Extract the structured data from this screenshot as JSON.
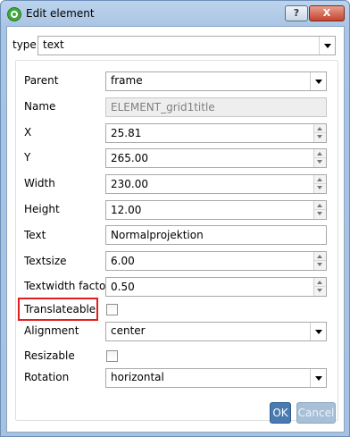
{
  "window": {
    "title": "Edit element"
  },
  "titlebar": {
    "help_label": "?",
    "close_label": "X"
  },
  "type_row": {
    "label": "type",
    "value": "text"
  },
  "fields": {
    "parent": {
      "label": "Parent",
      "value": "frame"
    },
    "name": {
      "label": "Name",
      "value": "ELEMENT_grid1title"
    },
    "x": {
      "label": "X",
      "value": "25.81"
    },
    "y": {
      "label": "Y",
      "value": "265.00"
    },
    "width": {
      "label": "Width",
      "value": "230.00"
    },
    "height": {
      "label": "Height",
      "value": "12.00"
    },
    "text": {
      "label": "Text",
      "value": "Normalprojektion"
    },
    "textsize": {
      "label": "Textsize",
      "value": "6.00"
    },
    "textwidth_factor": {
      "label": "Textwidth factor",
      "value": "0.50"
    },
    "translateable": {
      "label": "Translateable",
      "checked": false
    },
    "alignment": {
      "label": "Alignment",
      "value": "center"
    },
    "resizable": {
      "label": "Resizable",
      "checked": false
    },
    "rotation": {
      "label": "Rotation",
      "value": "horizontal"
    }
  },
  "buttons": {
    "ok_label": "OK",
    "cancel_label": "Cancel"
  },
  "colors": {
    "highlight": "#e41e1e",
    "ok_button": "#4a7bb0",
    "cancel_button_disabled": "#a8bfd8"
  }
}
